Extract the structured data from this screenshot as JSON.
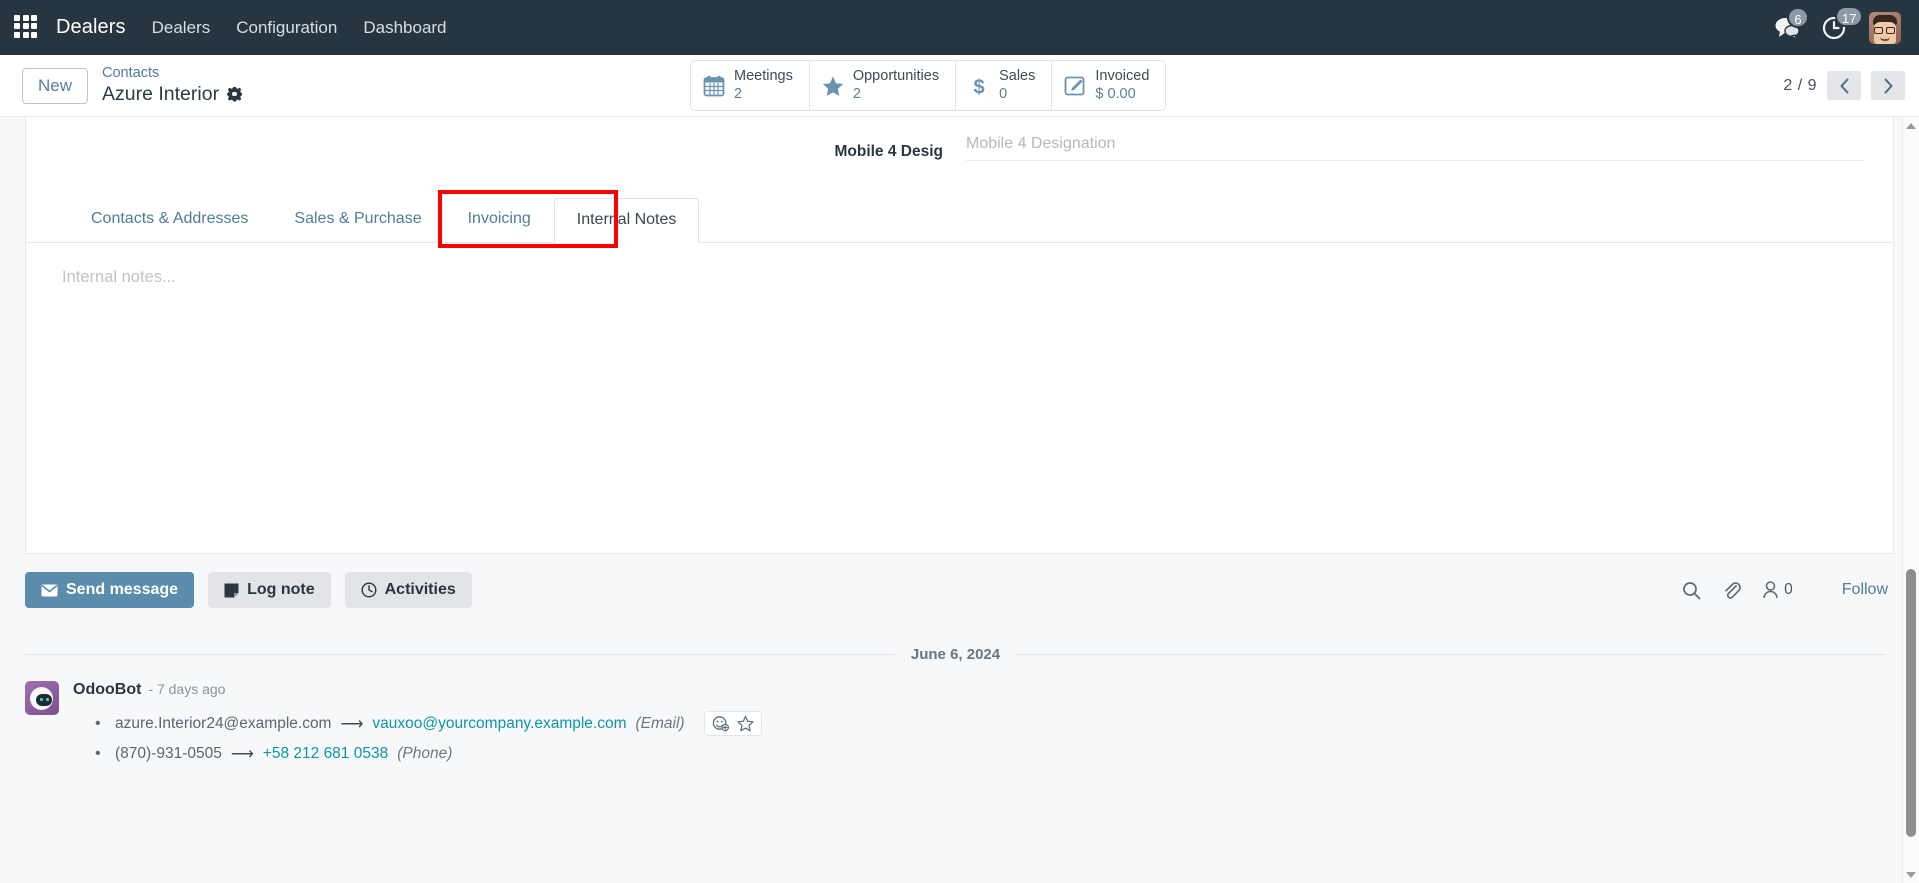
{
  "navbar": {
    "apps_icon": "apps-grid-icon",
    "brand": "Dealers",
    "menu": [
      {
        "label": "Dealers"
      },
      {
        "label": "Configuration"
      },
      {
        "label": "Dashboard"
      }
    ],
    "messages_icon": "messages-icon",
    "messages_count": "6",
    "activities_icon": "clock-icon",
    "activities_count": "17",
    "avatar": "user-avatar"
  },
  "control_panel": {
    "new_label": "New",
    "breadcrumb_parent": "Contacts",
    "breadcrumb_current": "Azure Interior",
    "settings_icon": "gear-icon",
    "stat_buttons": [
      {
        "icon": "calendar-icon",
        "label": "Meetings",
        "value": "2"
      },
      {
        "icon": "star-icon",
        "label": "Opportunities",
        "value": "2"
      },
      {
        "icon": "dollar-icon",
        "label": "Sales",
        "value": "0"
      },
      {
        "icon": "invoice-pencil-icon",
        "label": "Invoiced",
        "value": "$ 0.00"
      }
    ],
    "pager": {
      "count": "2 / 9",
      "prev_icon": "chevron-left-icon",
      "next_icon": "chevron-right-icon"
    }
  },
  "form": {
    "field": {
      "label": "Mobile 4 Desig",
      "placeholder": "Mobile 4 Designation",
      "value": ""
    },
    "tabs": [
      {
        "label": "Contacts & Addresses",
        "active": false
      },
      {
        "label": "Sales & Purchase",
        "active": false
      },
      {
        "label": "Invoicing",
        "active": false
      },
      {
        "label": "Internal Notes",
        "active": true
      }
    ],
    "notes_placeholder": "Internal notes..."
  },
  "chatter": {
    "send_message_label": "Send message",
    "send_message_icon": "envelope-icon",
    "log_note_label": "Log note",
    "log_note_icon": "note-icon",
    "activities_label": "Activities",
    "activities_icon": "clock-circle-icon",
    "search_icon": "search-icon",
    "attachment_icon": "paperclip-icon",
    "followers_icon": "user-icon",
    "followers_count": "0",
    "follow_label": "Follow",
    "date_separator": "June 6, 2024",
    "message": {
      "author": "OdooBot",
      "time": "- 7 days ago",
      "avatar": "odoobot-avatar",
      "tracking": [
        {
          "old": "azure.Interior24@example.com",
          "arrow": "⟶",
          "new": "vauxoo@yourcompany.example.com",
          "field": "(Email)"
        },
        {
          "old": "(870)-931-0505",
          "arrow": "⟶",
          "new": "+58 212 681 0538",
          "field": "(Phone)"
        }
      ],
      "actions": {
        "add_reaction_icon": "add-reaction-icon",
        "star_icon": "star-outline-icon"
      }
    }
  },
  "scrollbar": {
    "up_icon": "scroll-up-arrow-icon",
    "down_icon": "scroll-down-arrow-icon"
  },
  "annotation": {
    "highlight_color": "#fa0000",
    "target": "Internal Notes"
  }
}
